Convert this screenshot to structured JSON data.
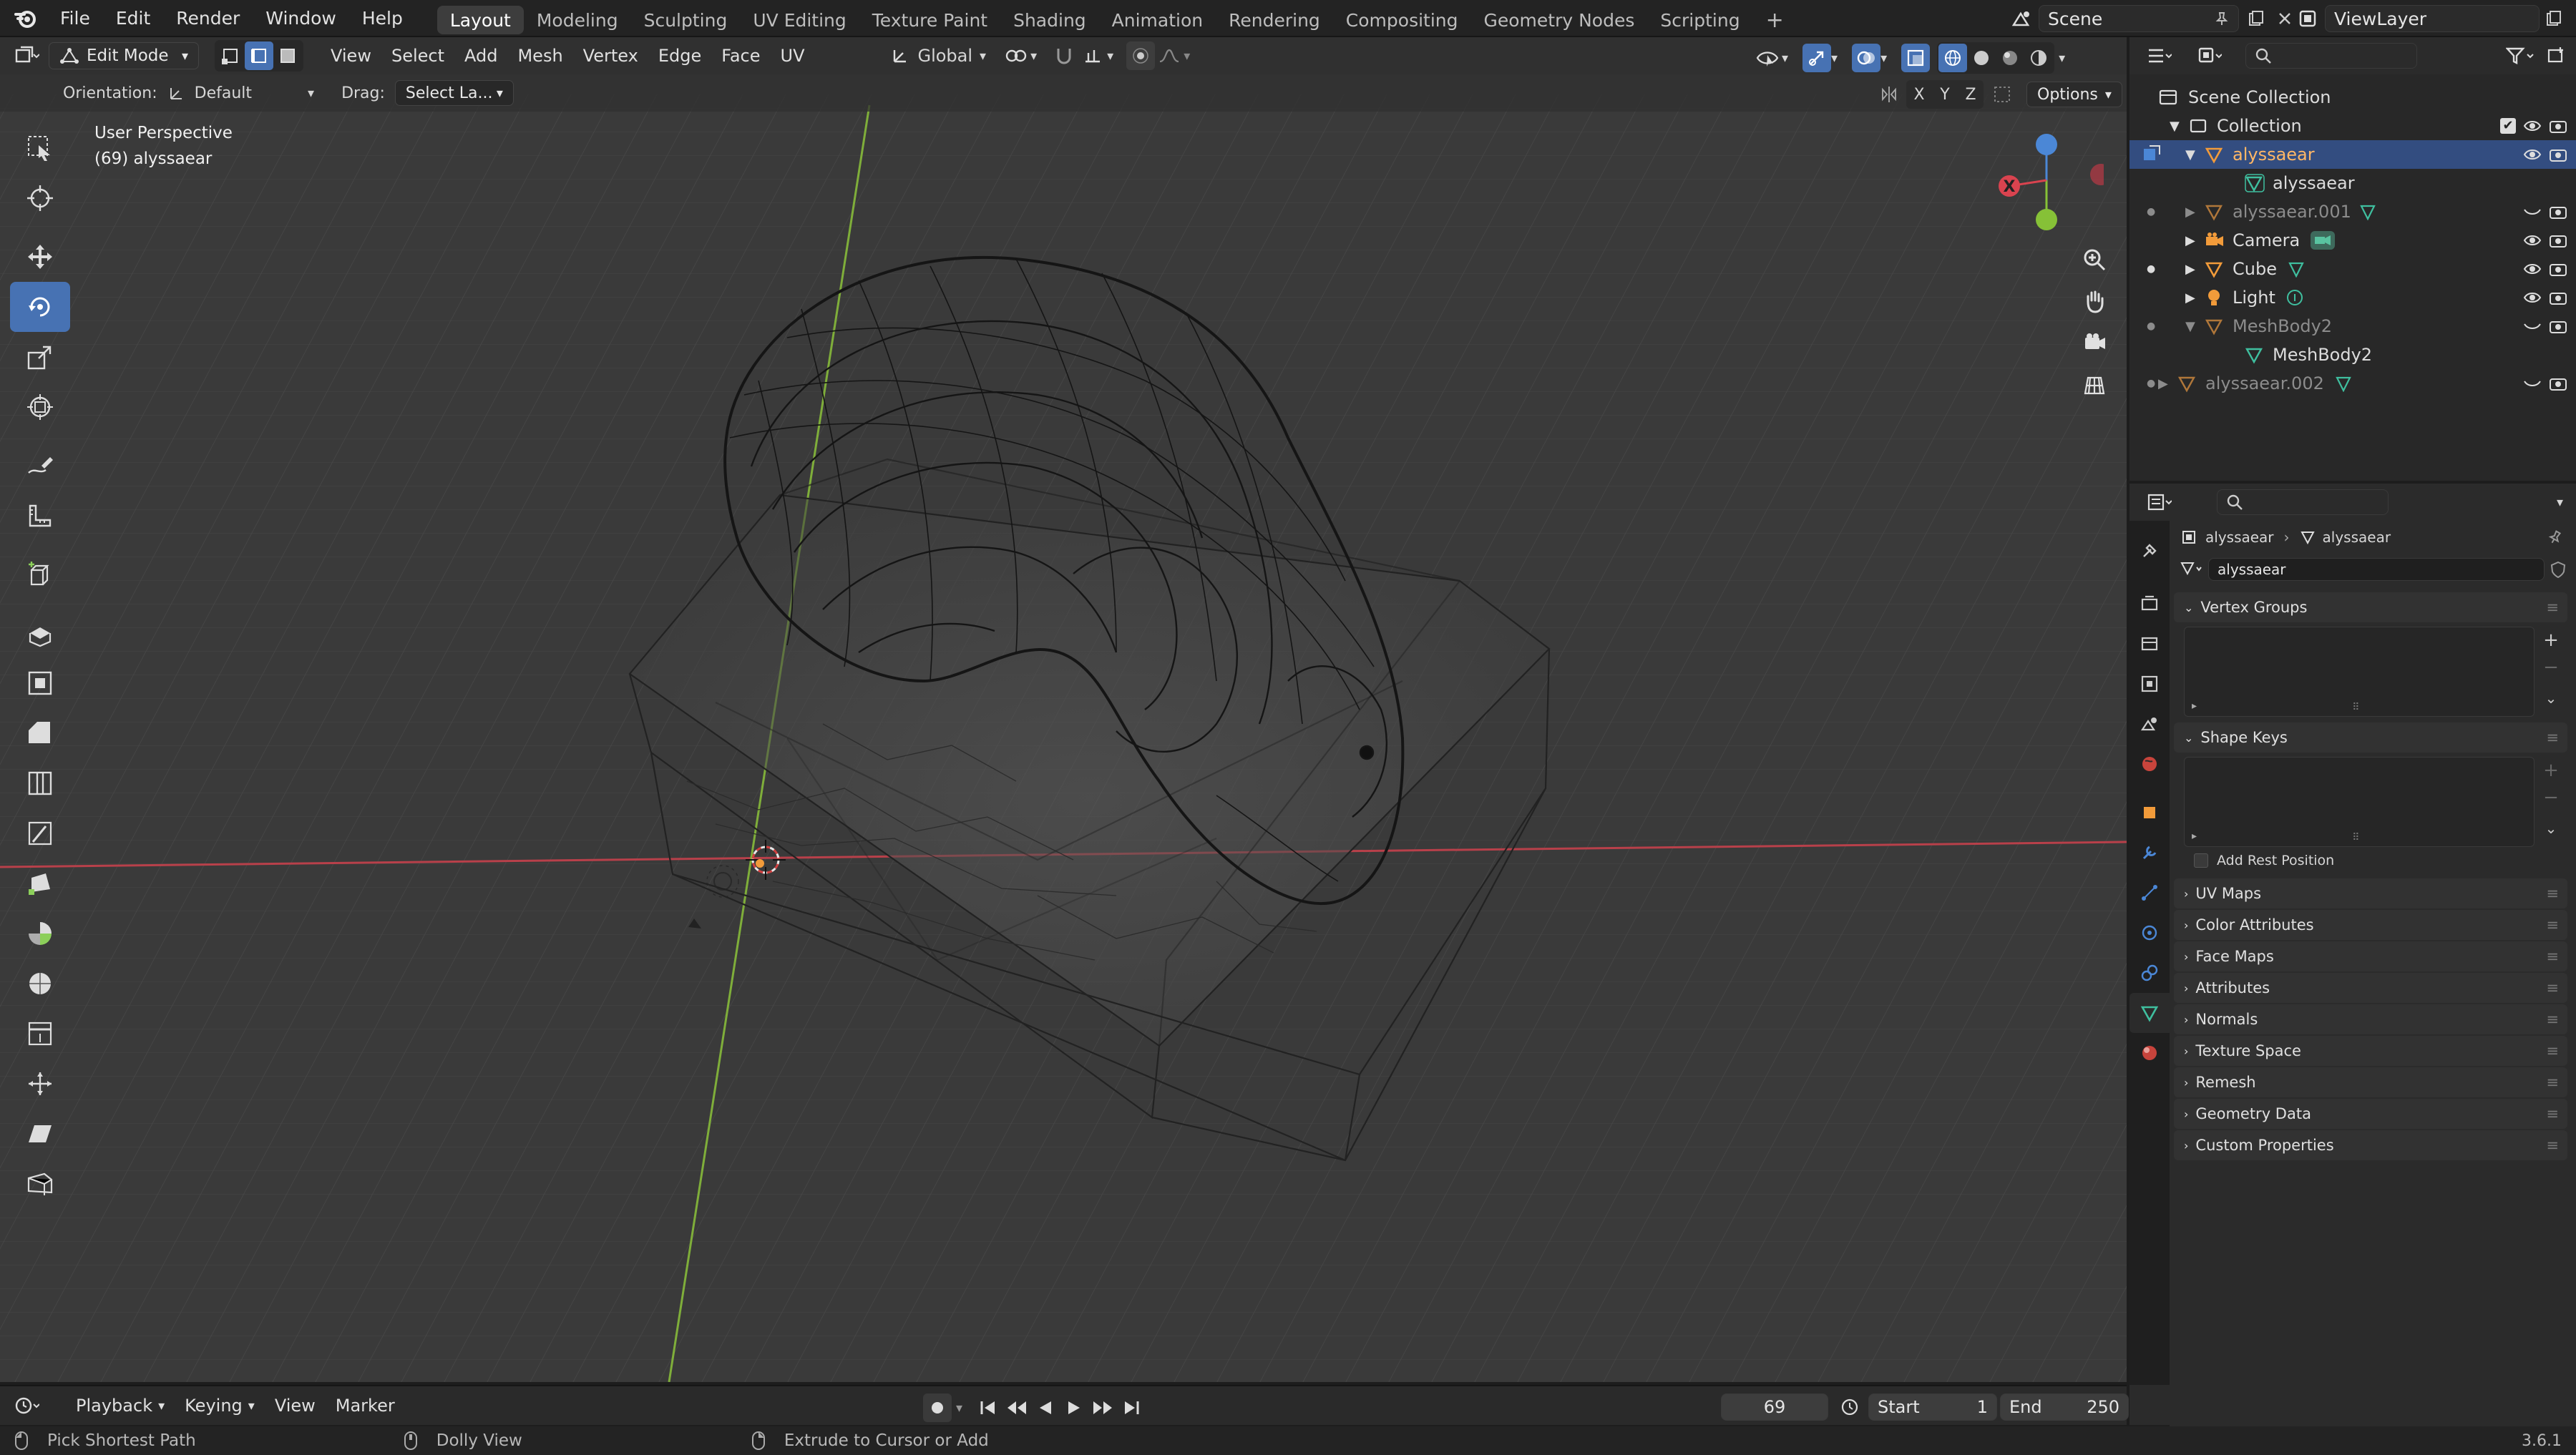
{
  "topbar": {
    "menus": [
      "File",
      "Edit",
      "Render",
      "Window",
      "Help"
    ],
    "workspaces": [
      "Layout",
      "Modeling",
      "Sculpting",
      "UV Editing",
      "Texture Paint",
      "Shading",
      "Animation",
      "Rendering",
      "Compositing",
      "Geometry Nodes",
      "Scripting"
    ],
    "active_workspace": "Layout",
    "add_tab": "+",
    "scene_name": "Scene",
    "view_layer": "ViewLayer"
  },
  "viewport": {
    "mode": "Edit Mode",
    "menus": [
      "View",
      "Select",
      "Add",
      "Mesh",
      "Vertex",
      "Edge",
      "Face",
      "UV"
    ],
    "transform_orientation": "Global",
    "tool_settings": {
      "orientation_label": "Orientation:",
      "orientation_value": "Default",
      "drag_label": "Drag:",
      "drag_value": "Select La...",
      "axis_x": "X",
      "axis_y": "Y",
      "axis_z": "Z",
      "options": "Options"
    },
    "overlay_text": {
      "perspective": "User Perspective",
      "object_info": "(69) alyssaear"
    },
    "gizmo": {
      "x": "X"
    },
    "colors": {
      "x_axis": "#d9434f",
      "y_axis": "#86c137",
      "z_axis": "#4b87d6",
      "active": "#4772b3"
    }
  },
  "outliner": {
    "root": "Scene Collection",
    "items": [
      {
        "label": "Collection",
        "kind": "collection"
      },
      {
        "label": "alyssaear",
        "kind": "mesh-object",
        "selected": true
      },
      {
        "label": "alyssaear",
        "kind": "mesh-data"
      },
      {
        "label": "alyssaear.001",
        "kind": "mesh-object",
        "dim": true
      },
      {
        "label": "Camera",
        "kind": "camera"
      },
      {
        "label": "Cube",
        "kind": "mesh-object"
      },
      {
        "label": "Light",
        "kind": "light"
      },
      {
        "label": "MeshBody2",
        "kind": "mesh-object",
        "dim": true
      },
      {
        "label": "MeshBody2",
        "kind": "mesh-data"
      },
      {
        "label": "alyssaear.002",
        "kind": "mesh-object",
        "dim": true
      }
    ]
  },
  "properties": {
    "breadcrumb": [
      "alyssaear",
      "alyssaear"
    ],
    "datablock_name": "alyssaear",
    "panels": {
      "vertex_groups": "Vertex Groups",
      "shape_keys": "Shape Keys",
      "add_rest_position": "Add Rest Position",
      "collapsed": [
        "UV Maps",
        "Color Attributes",
        "Face Maps",
        "Attributes",
        "Normals",
        "Texture Space",
        "Remesh",
        "Geometry Data",
        "Custom Properties"
      ]
    }
  },
  "timeline": {
    "menus": [
      "Playback",
      "Keying",
      "View",
      "Marker"
    ],
    "current_frame": "69",
    "start_label": "Start",
    "start_value": "1",
    "end_label": "End",
    "end_value": "250"
  },
  "statusbar": {
    "hint1": "Pick Shortest Path",
    "hint2": "Dolly View",
    "hint3": "Extrude to Cursor or Add",
    "version": "3.6.1"
  }
}
